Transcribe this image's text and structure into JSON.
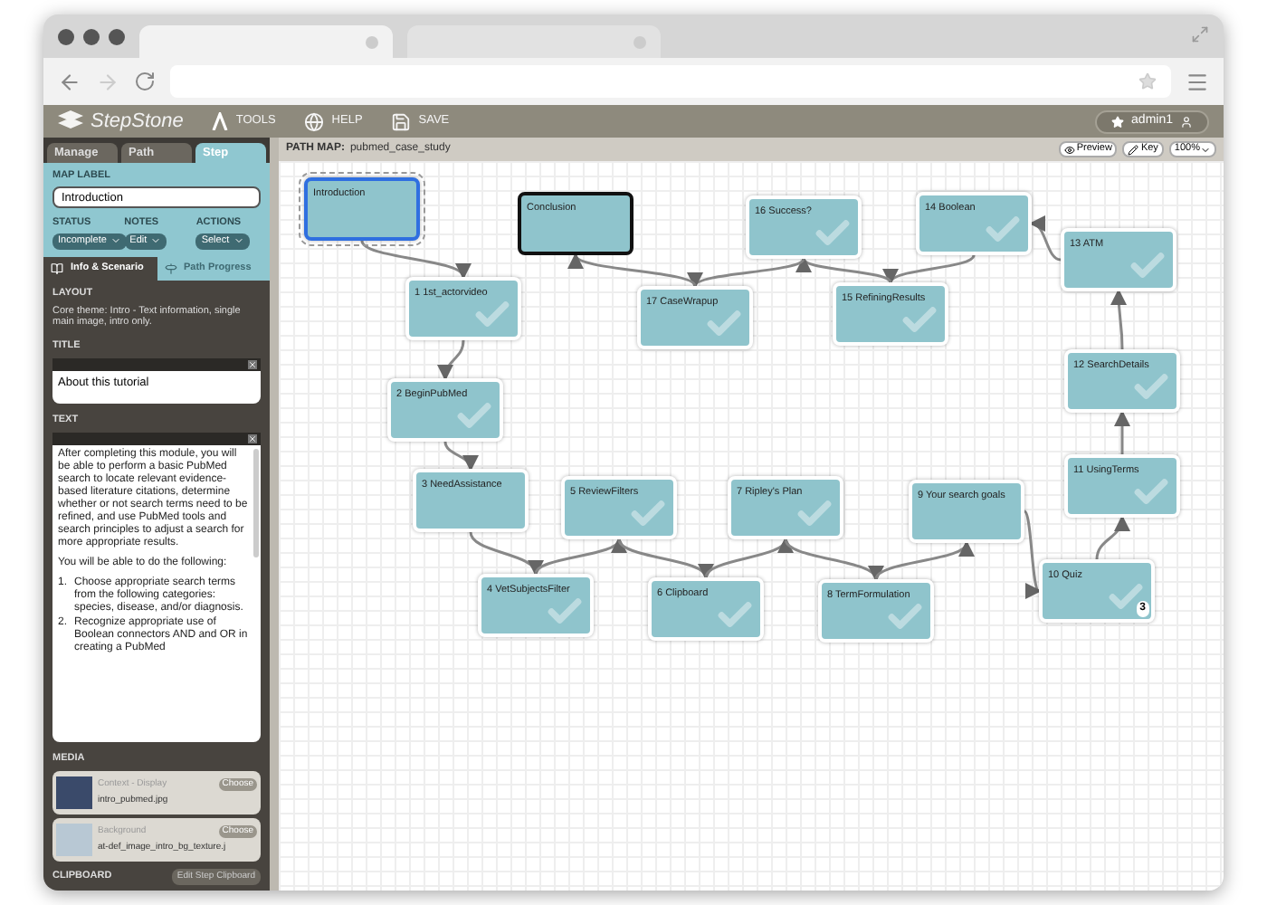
{
  "app": {
    "logo": "StepStone",
    "toolbar": [
      {
        "label": "TOOLS",
        "kind": "tools"
      },
      {
        "label": "HELP",
        "kind": "help"
      },
      {
        "label": "SAVE",
        "kind": "save"
      }
    ],
    "user": "admin1"
  },
  "sidebar": {
    "tabs": [
      {
        "label": "Manage",
        "selected": false
      },
      {
        "label": "Path",
        "selected": false
      },
      {
        "label": "Step",
        "selected": true
      }
    ],
    "map_label": {
      "label": "MAP LABEL",
      "value": "Introduction"
    },
    "dropdowns": [
      {
        "label": "STATUS",
        "value": "Incomplete"
      },
      {
        "label": "NOTES",
        "value": "Edit"
      },
      {
        "label": "ACTIONS",
        "value": "Select"
      }
    ],
    "subtabs": [
      {
        "label": "Info & Scenario",
        "selected": true,
        "kind": "book"
      },
      {
        "label": "Path Progress",
        "selected": false,
        "kind": "signpost"
      }
    ],
    "layout": {
      "heading": "LAYOUT",
      "text": "Core theme: Intro - Text information, single main image, intro only."
    },
    "title": {
      "heading": "TITLE",
      "value": "About this tutorial"
    },
    "text": {
      "heading": "TEXT",
      "paragraphs": [
        "After completing this module, you will be able to perform a basic PubMed search to locate relevant evidence-based literature citations, determine whether or not search terms need to be refined, and use PubMed tools and search principles to adjust a search for more appropriate results.",
        "You will be able to do the following:"
      ],
      "list": [
        {
          "number": "1.",
          "text": "Choose appropriate search terms from the following categories: species, disease, and/or diagnosis."
        },
        {
          "number": "2.",
          "text": "Recognize appropriate use of Boolean connectors AND and OR in creating a PubMed"
        }
      ]
    },
    "media": {
      "heading": "MEDIA",
      "items": [
        {
          "caption": "Context - Display",
          "file": "intro_pubmed.jpg",
          "button": "Choose"
        },
        {
          "caption": "Background",
          "file": "at-def_image_intro_bg_texture.j",
          "button": "Choose"
        }
      ]
    },
    "clipboard": {
      "heading": "CLIPBOARD",
      "button": "Edit Step Clipboard"
    }
  },
  "path_map": {
    "label": "PATH MAP:",
    "name": "pubmed_case_study",
    "buttons": [
      {
        "label": "Preview",
        "kind": "eye"
      },
      {
        "label": "Key",
        "kind": "pencil"
      }
    ],
    "zoom": "100%",
    "nodes": [
      {
        "label": "Introduction",
        "kind": "step",
        "completed": false,
        "selected": true
      },
      {
        "label": "Conclusion",
        "kind": "end",
        "completed": false,
        "selected": false
      },
      {
        "label": "16 Success?",
        "kind": "step",
        "completed": true,
        "selected": false
      },
      {
        "label": "14 Boolean",
        "kind": "step",
        "completed": true,
        "selected": false
      },
      {
        "label": "13 ATM",
        "kind": "step",
        "completed": true,
        "selected": false
      },
      {
        "label": "1 1st_actorvideo",
        "kind": "step",
        "completed": true,
        "selected": false
      },
      {
        "label": "17 CaseWrapup",
        "kind": "step",
        "completed": true,
        "selected": false
      },
      {
        "label": "15 RefiningResults",
        "kind": "step",
        "completed": true,
        "selected": false
      },
      {
        "label": "12 SearchDetails",
        "kind": "step",
        "completed": true,
        "selected": false
      },
      {
        "label": "2 BeginPubMed",
        "kind": "step",
        "completed": true,
        "selected": false
      },
      {
        "label": "11 UsingTerms",
        "kind": "step",
        "completed": true,
        "selected": false
      },
      {
        "label": "3 NeedAssistance",
        "kind": "step",
        "completed": false,
        "selected": false
      },
      {
        "label": "5 ReviewFilters",
        "kind": "step",
        "completed": true,
        "selected": false
      },
      {
        "label": "7 Ripley's Plan",
        "kind": "step",
        "completed": true,
        "selected": false
      },
      {
        "label": "9 Your search goals",
        "kind": "step",
        "completed": false,
        "selected": false
      },
      {
        "label": "4 VetSubjectsFilter",
        "kind": "step",
        "completed": true,
        "selected": false
      },
      {
        "label": "6 Clipboard",
        "kind": "step",
        "completed": true,
        "selected": false
      },
      {
        "label": "8 TermFormulation",
        "kind": "step",
        "completed": true,
        "selected": false
      },
      {
        "label": "10 Quiz",
        "kind": "step",
        "completed": true,
        "selected": false,
        "badge": "3"
      }
    ]
  }
}
